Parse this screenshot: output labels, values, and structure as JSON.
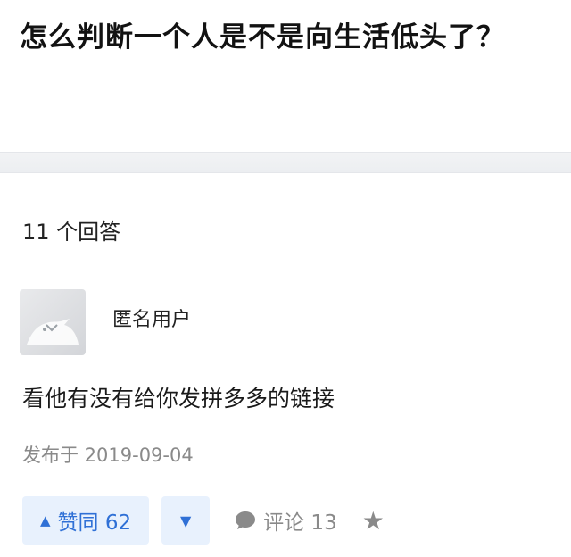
{
  "question": {
    "title": "怎么判断一个人是不是向生活低头了？"
  },
  "answers_header": {
    "count_label": "11 个回答"
  },
  "answer": {
    "author": "匿名用户",
    "text": "看他有没有给你发拼多多的链接",
    "date": "发布于 2019-09-04",
    "upvote_label": "赞同 62",
    "comment_label": "评论 13",
    "icons": {
      "upvote": "triangle-up-icon",
      "downvote": "triangle-down-icon",
      "comment": "speech-bubble-icon",
      "favorite": "star-icon"
    }
  },
  "colors": {
    "accent": "#2f70d6",
    "accent_bg": "#e8f1fd",
    "muted": "#8a8a8a"
  }
}
